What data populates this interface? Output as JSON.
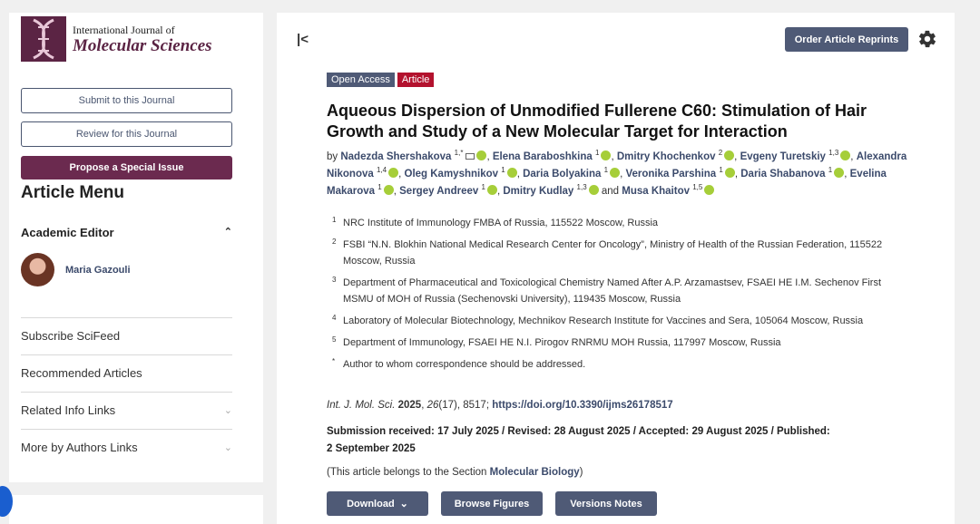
{
  "sidebar": {
    "logo_line1": "International Journal of",
    "logo_line2": "Molecular Sciences",
    "submit_label": "Submit to this Journal",
    "review_label": "Review for this Journal",
    "propose_label": "Propose a Special Issue",
    "menu_title": "Article Menu",
    "academic_editor_label": "Academic Editor",
    "editor_name": "Maria Gazouli",
    "links": [
      {
        "label": "Subscribe SciFeed"
      },
      {
        "label": "Recommended Articles"
      },
      {
        "label": "Related Info Links"
      },
      {
        "label": "More by Authors Links"
      }
    ]
  },
  "header": {
    "reprints_label": "Order Article Reprints"
  },
  "article": {
    "badge_open_access": "Open Access",
    "badge_type": "Article",
    "title": "Aqueous Dispersion of Unmodified Fullerene C60: Stimulation of Hair Growth and Study of a New Molecular Target for Interaction",
    "by": "by",
    "and": "and",
    "authors": [
      {
        "name": "Nadezda Shershakova",
        "sup": "1,*"
      },
      {
        "name": "Elena Baraboshkina",
        "sup": "1"
      },
      {
        "name": "Dmitry Khochenkov",
        "sup": "2"
      },
      {
        "name": "Evgeny Turetskiy",
        "sup": "1,3"
      },
      {
        "name": "Alexandra Nikonova",
        "sup": "1,4"
      },
      {
        "name": "Oleg Kamyshnikov",
        "sup": "1"
      },
      {
        "name": "Daria Bolyakina",
        "sup": "1"
      },
      {
        "name": "Veronika Parshina",
        "sup": "1"
      },
      {
        "name": "Daria Shabanova",
        "sup": "1"
      },
      {
        "name": "Evelina Makarova",
        "sup": "1"
      },
      {
        "name": "Sergey Andreev",
        "sup": "1"
      },
      {
        "name": "Dmitry Kudlay",
        "sup": "1,3"
      },
      {
        "name": "Musa Khaitov",
        "sup": "1,5"
      }
    ],
    "affiliations": [
      {
        "num": "1",
        "text": "NRC Institute of Immunology FMBA of Russia, 115522 Moscow, Russia"
      },
      {
        "num": "2",
        "text": "FSBI “N.N. Blokhin National Medical Research Center for Oncology”, Ministry of Health of the Russian Federation, 115522 Moscow, Russia"
      },
      {
        "num": "3",
        "text": "Department of Pharmaceutical and Toxicological Chemistry Named After A.P. Arzamastsev, FSAEI HE I.M. Sechenov First MSMU of MOH of Russia (Sechenovski University), 119435 Moscow, Russia"
      },
      {
        "num": "4",
        "text": "Laboratory of Molecular Biotechnology, Mechnikov Research Institute for Vaccines and Sera, 105064 Moscow, Russia"
      },
      {
        "num": "5",
        "text": "Department of Immunology, FSAEI HE N.I. Pirogov RNRMU MOH Russia, 117997 Moscow, Russia"
      },
      {
        "num": "*",
        "text": "Author to whom correspondence should be addressed."
      }
    ],
    "citation": {
      "journal": "Int. J. Mol. Sci.",
      "year": "2025",
      "volume": "26",
      "rest": "(17), 8517;",
      "doi": "https://doi.org/10.3390/ijms26178517"
    },
    "dates": "Submission received: 17 July 2025 / Revised: 28 August 2025 / Accepted: 29 August 2025 / Published: 2 September 2025",
    "section_prefix": "(This article belongs to the Section ",
    "section_name": "Molecular Biology",
    "section_suffix": ")",
    "download_label": "Download",
    "browse_label": "Browse Figures",
    "versions_label": "Versions Notes"
  },
  "icons": {
    "collapse": "collapse-sidebar-icon",
    "gear": "gear-icon",
    "orcid": "orcid-icon",
    "email": "envelope-icon",
    "chevron_up": "chevron-up-icon",
    "chevron_down": "chevron-down-icon"
  },
  "colors": {
    "journal": "#6b2a4f",
    "button": "#4f5a76",
    "article_badge": "#b3122e",
    "orcid": "#a6ce39",
    "link": "#3b4a6b"
  }
}
